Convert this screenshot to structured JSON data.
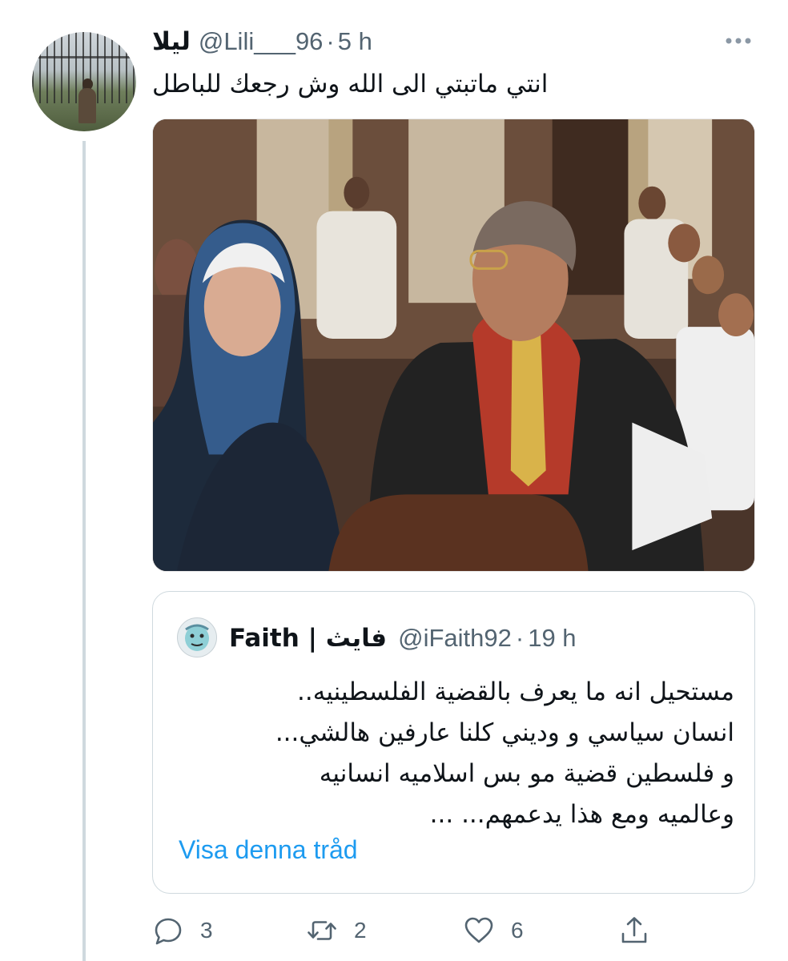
{
  "tweet": {
    "author_name": "ليلا",
    "handle": "@Lili___96",
    "separator": "·",
    "time": "5 h",
    "text": "انتي ماتبتي الى الله وش رجعك للباطل",
    "more_icon": "ellipsis-icon"
  },
  "quoted_tweet": {
    "author_name": "Faith | فايث",
    "handle": "@iFaith92",
    "separator": "·",
    "time": "19 h",
    "text_lines": [
      "مستحيل انه ما يعرف بالقضية الفلسطينيه..",
      "انسان سياسي و وديني كلنا عارفين هالشي...",
      "و فلسطين قضية مو بس اسلاميه انسانيه",
      "وعالميه ومع هذا يدعمهم... ..."
    ],
    "show_thread": "Visa denna tråd"
  },
  "actions": {
    "reply": {
      "icon": "reply-icon",
      "count": "3"
    },
    "retweet": {
      "icon": "retweet-icon",
      "count": "2"
    },
    "like": {
      "icon": "heart-icon",
      "count": "6"
    },
    "share": {
      "icon": "share-icon"
    }
  },
  "colors": {
    "text_primary": "#0f1419",
    "text_secondary": "#536471",
    "link": "#1d9bf0",
    "border": "#cfd9de"
  }
}
